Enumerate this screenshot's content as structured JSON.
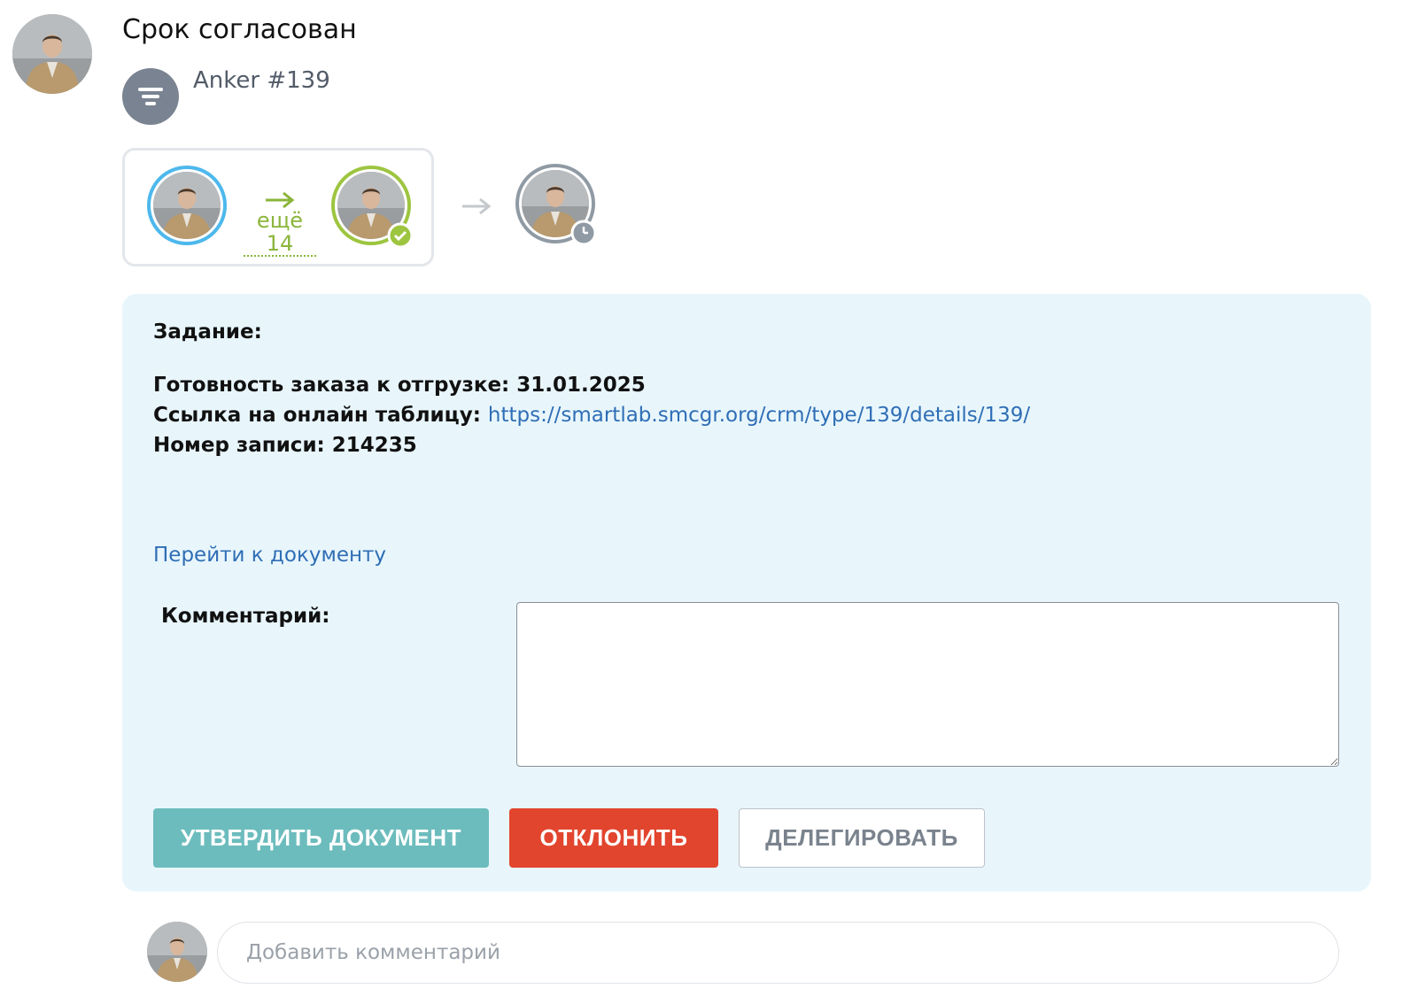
{
  "header": {
    "title": "Срок согласован",
    "entity_name": "Anker #139",
    "entity_icon": "funnel-icon",
    "author_avatar": "user-avatar"
  },
  "flow": {
    "more_label": "ещё 14",
    "steps": [
      {
        "role": "initiator",
        "status": "started",
        "ring_color": "#4db8ec"
      },
      {
        "role": "approver",
        "status": "approved",
        "ring_color": "#9dc540",
        "badge_icon": "check-icon"
      },
      {
        "role": "next",
        "status": "pending",
        "ring_color": "#8f9aa4",
        "badge_icon": "clock-icon"
      }
    ]
  },
  "task": {
    "heading": "Задание:",
    "readiness_label": "Готовность заказа к отгрузке:",
    "readiness_value": "31.01.2025",
    "link_label": "Ссылка на онлайн таблицу:",
    "link_url": "https://smartlab.smcgr.org/crm/type/139/details/139/",
    "record_label": "Номер записи:",
    "record_value": "214235",
    "go_to_document": "Перейти к документу",
    "comment_label": "Комментарий:",
    "comment_value": ""
  },
  "actions": {
    "approve": "УТВЕРДИТЬ ДОКУМЕНТ",
    "reject": "ОТКЛОНИТЬ",
    "delegate": "ДЕЛЕГИРОВАТЬ"
  },
  "footer": {
    "comment_placeholder": "Добавить комментарий"
  },
  "colors": {
    "approve": "#6cbcbd",
    "reject": "#e2452e",
    "link": "#2f6eb5",
    "card_bg": "#e8f6fc",
    "more_label": "#8ab53b"
  }
}
